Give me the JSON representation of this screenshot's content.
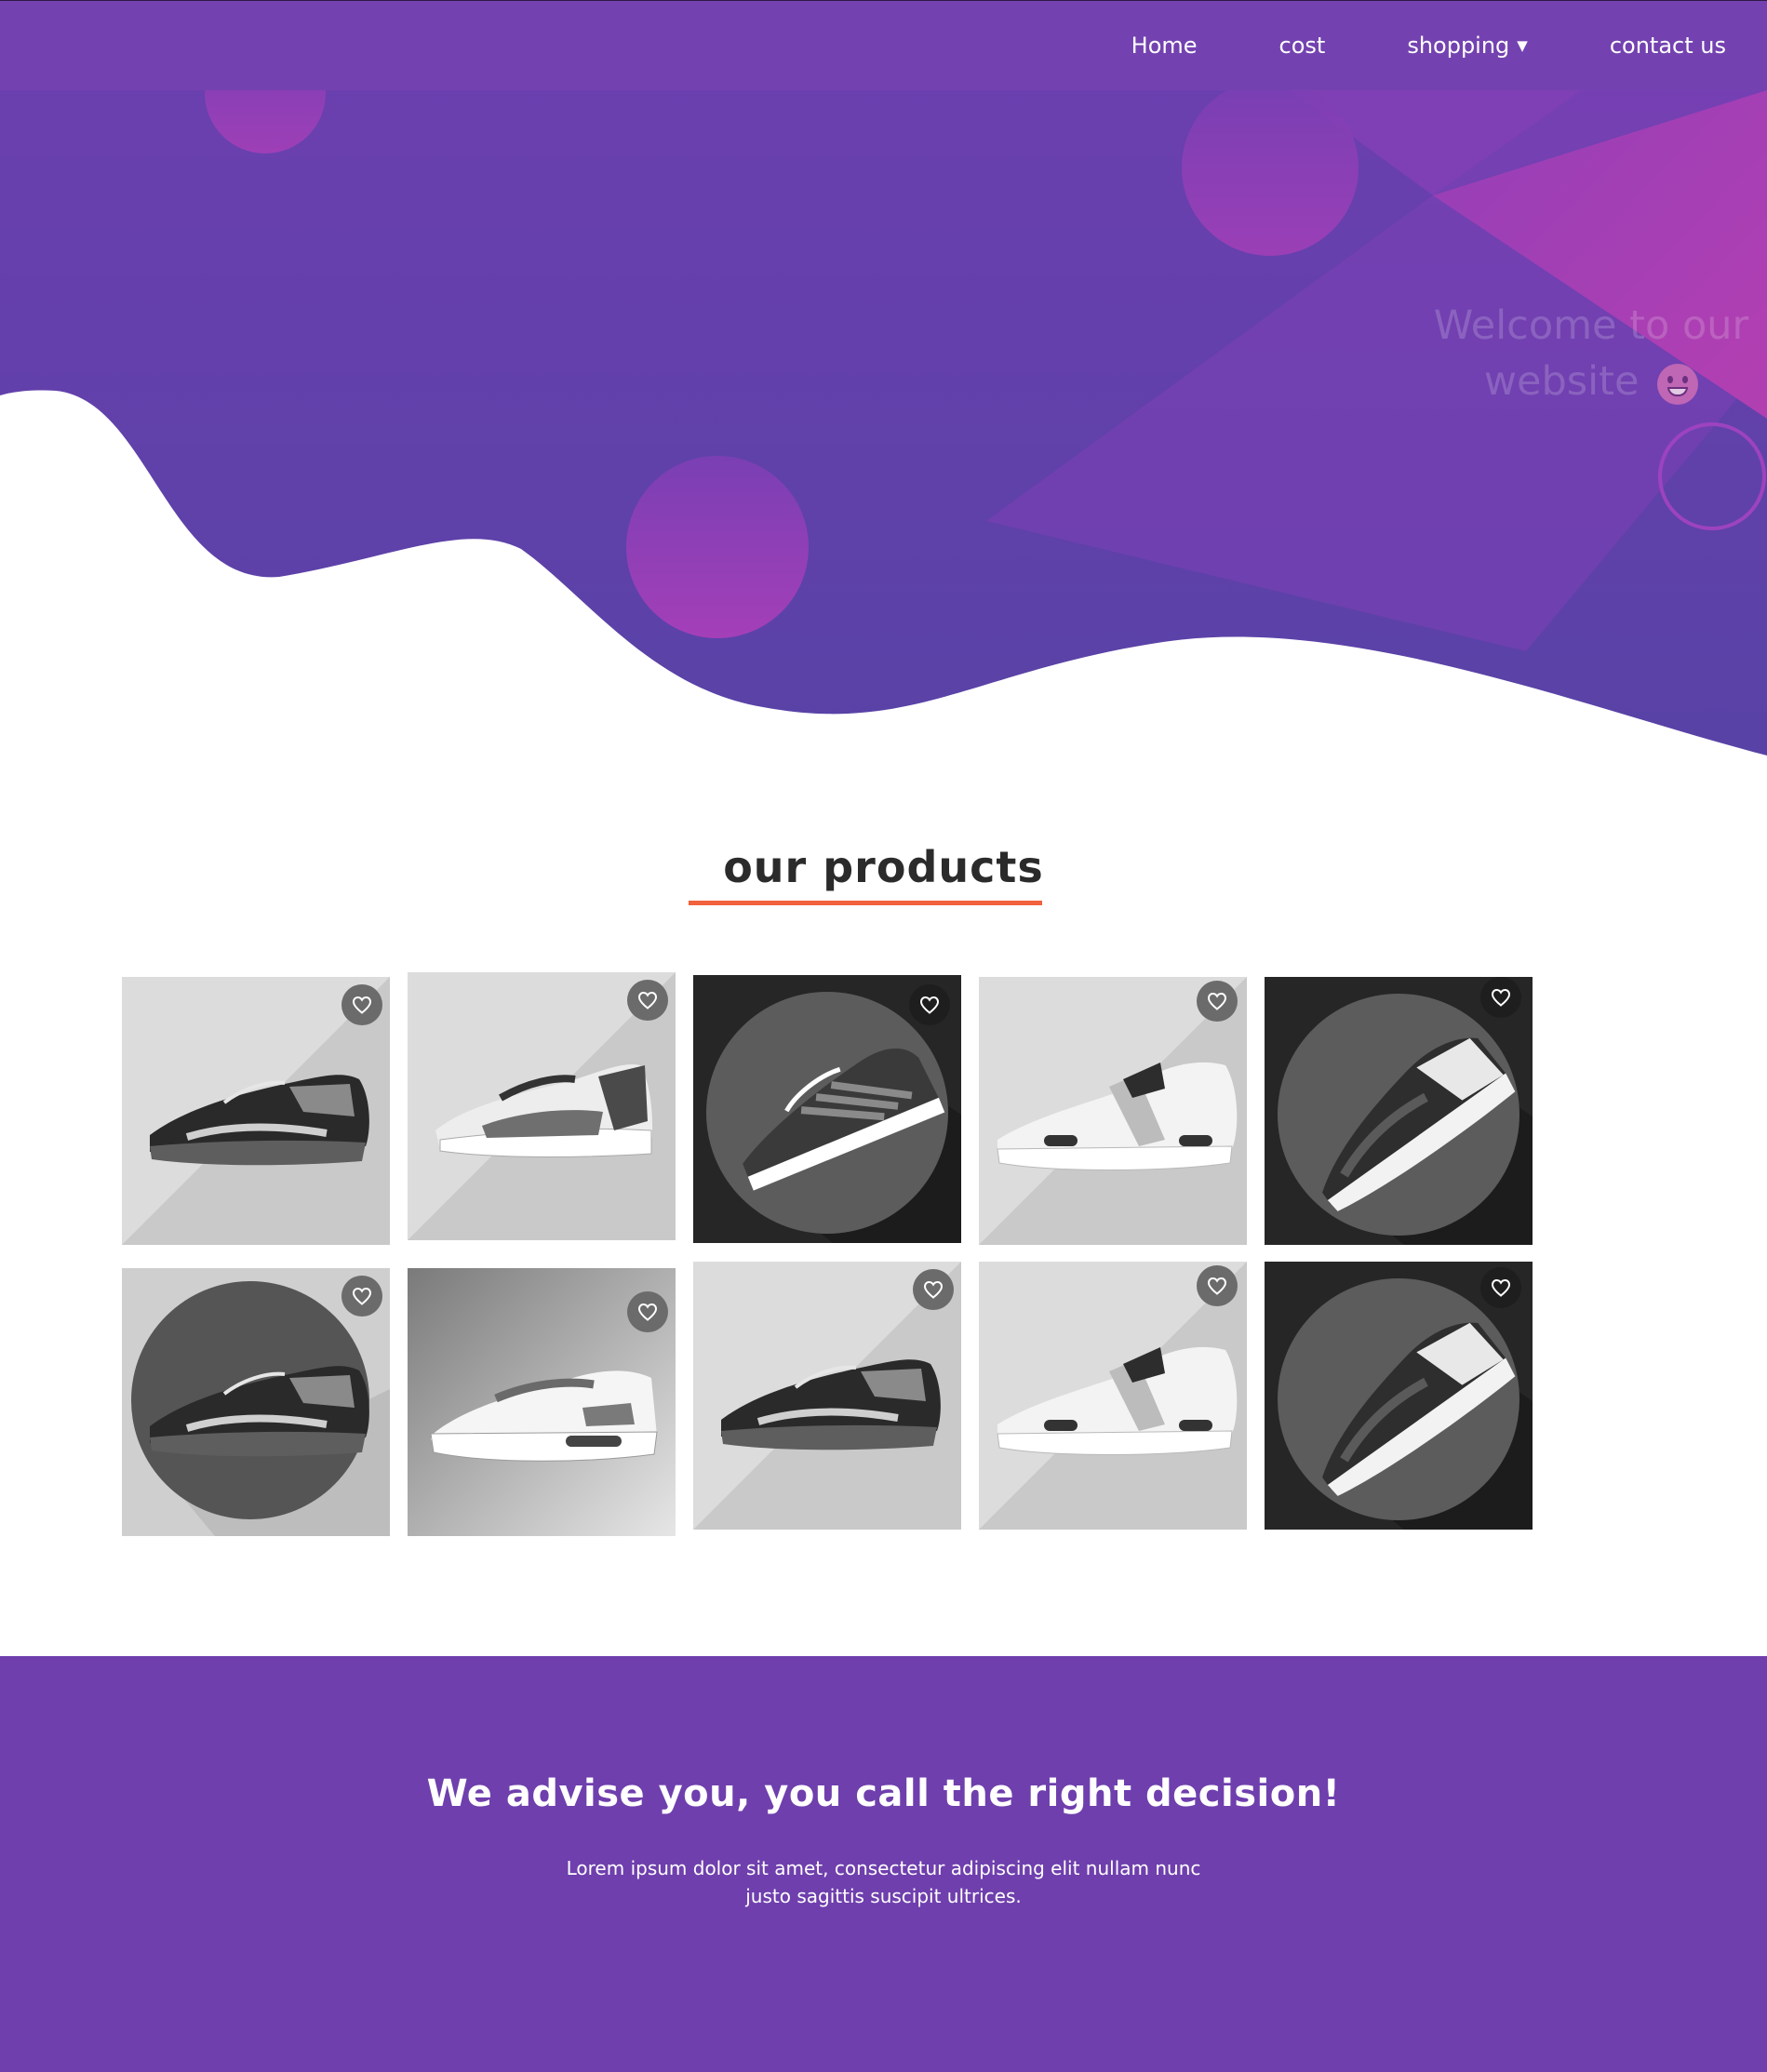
{
  "nav": {
    "items": [
      {
        "label": "Home"
      },
      {
        "label": "cost"
      },
      {
        "label": "shopping",
        "has_dropdown": true
      },
      {
        "label": "contact us"
      }
    ]
  },
  "hero": {
    "welcome_text": "Welcome to our website",
    "colors": {
      "purple": "#6a3fb0",
      "magenta": "#b23fb6",
      "wave_bottom": "#5a3fa8"
    }
  },
  "products": {
    "title": "our products",
    "underline_color": "#f1623e",
    "items": [
      {
        "name": "shoe-black-gray-runner",
        "style": "dark-runner",
        "bg": "light"
      },
      {
        "name": "shoe-fashion-gray-white",
        "style": "gray-sneaker",
        "bg": "light"
      },
      {
        "name": "shoe-striped-dark",
        "style": "striped",
        "bg": "dark-circle"
      },
      {
        "name": "shoe-white-first-strap",
        "style": "white-strap",
        "bg": "light"
      },
      {
        "name": "shoe-black-huarache",
        "style": "huarache",
        "bg": "dark-circle"
      },
      {
        "name": "shoe-black-gray-circle",
        "style": "dark-runner",
        "bg": "light-circle"
      },
      {
        "name": "shoe-white-air",
        "style": "white-air",
        "bg": "gray"
      },
      {
        "name": "shoe-black-gray-runner-2",
        "style": "dark-runner",
        "bg": "light"
      },
      {
        "name": "shoe-white-first-strap-2",
        "style": "white-strap",
        "bg": "light"
      },
      {
        "name": "shoe-black-huarache-2",
        "style": "huarache",
        "bg": "dark-circle"
      }
    ],
    "favorite_icon": "heart-outline-icon"
  },
  "footer": {
    "heading": "We advise you, you call the right decision!",
    "text": "Lorem ipsum dolor sit amet, consectetur adipiscing elit nullam nunc justo sagittis suscipit ultrices.",
    "bg_color": "#6f3fad"
  }
}
